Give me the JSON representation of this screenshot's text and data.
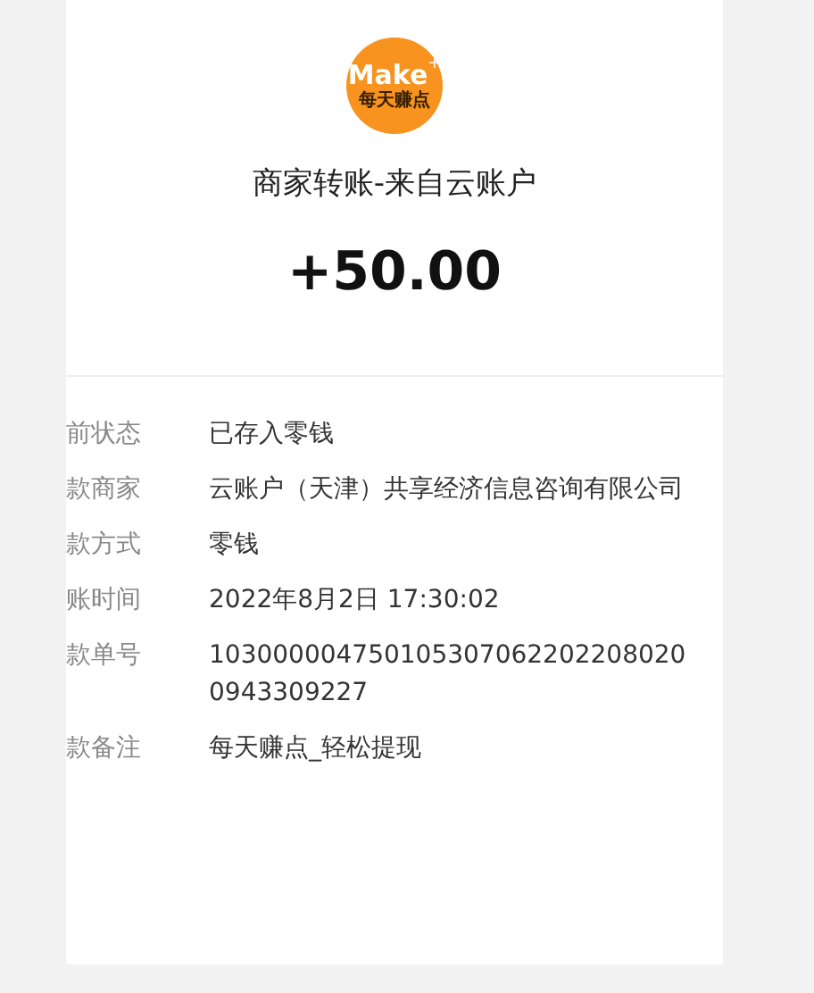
{
  "logo": {
    "text": "Make",
    "plus": "+",
    "subtitle": "每天赚点"
  },
  "title": "商家转账-来自云账户",
  "amount": "+50.00",
  "details": [
    {
      "label": "前状态",
      "value": "已存入零钱"
    },
    {
      "label": "款商家",
      "value": "云账户（天津）共享经济信息咨询有限公司"
    },
    {
      "label": "款方式",
      "value": "零钱"
    },
    {
      "label": "账时间",
      "value": "2022年8月2日 17:30:02"
    },
    {
      "label": "款单号",
      "value": "1030000047501053070622022080200943309227"
    },
    {
      "label": "款备注",
      "value": "每天赚点_轻松提现"
    }
  ]
}
